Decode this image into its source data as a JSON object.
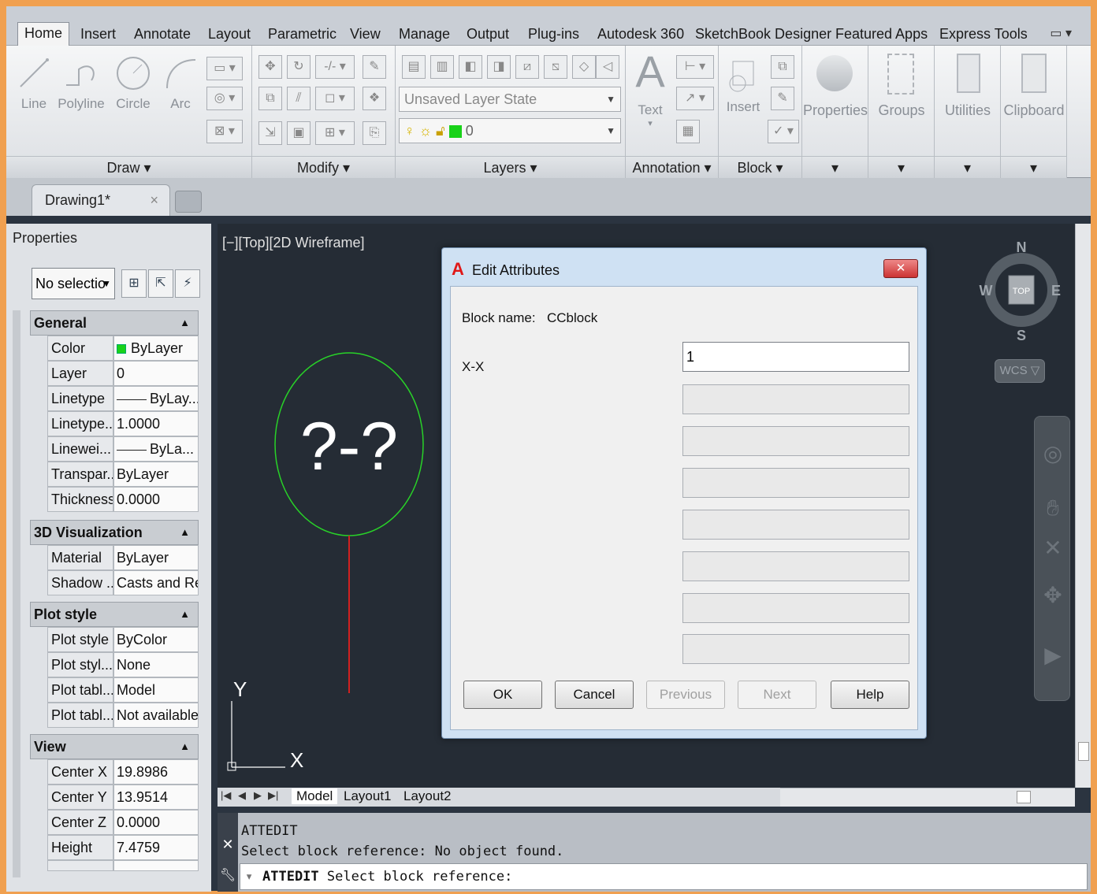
{
  "ribbon": {
    "tabs": [
      "Home",
      "Insert",
      "Annotate",
      "Layout",
      "Parametric",
      "View",
      "Manage",
      "Output",
      "Plug-ins",
      "Autodesk 360",
      "SketchBook Designer",
      "Featured Apps",
      "Express Tools"
    ],
    "active_tab": "Home",
    "extra_icon": "▭ ▾"
  },
  "draw_panel": {
    "title": "Draw ▾",
    "tools": [
      "Line",
      "Polyline",
      "Circle",
      "Arc"
    ]
  },
  "modify_panel": {
    "title": "Modify ▾"
  },
  "layers_panel": {
    "title": "Layers ▾",
    "layer_state": "Unsaved Layer State",
    "current_layer": "0"
  },
  "annotation_panel": {
    "title": "Annotation ▾",
    "text_label": "Text"
  },
  "block_panel": {
    "title": "Block ▾",
    "insert_label": "Insert"
  },
  "big_tools": [
    "Properties",
    "Groups",
    "Utilities",
    "Clipboard"
  ],
  "file_tab": {
    "name": "Drawing1*",
    "close": "×"
  },
  "properties": {
    "header": "Properties",
    "selection": "No selectio",
    "sections": {
      "general": {
        "title": "General",
        "rows": [
          {
            "k": "Color",
            "v": "ByLayer"
          },
          {
            "k": "Layer",
            "v": "0"
          },
          {
            "k": "Linetype",
            "v": "ByLay..."
          },
          {
            "k": "Linetype...",
            "v": "1.0000"
          },
          {
            "k": "Linewei...",
            "v": "ByLa..."
          },
          {
            "k": "Transpar...",
            "v": "ByLayer"
          },
          {
            "k": "Thickness",
            "v": "0.0000"
          }
        ]
      },
      "viz": {
        "title": "3D Visualization",
        "rows": [
          {
            "k": "Material",
            "v": "ByLayer"
          },
          {
            "k": "Shadow ...",
            "v": "Casts and Re..."
          }
        ]
      },
      "plot": {
        "title": "Plot style",
        "rows": [
          {
            "k": "Plot style",
            "v": "ByColor"
          },
          {
            "k": "Plot styl...",
            "v": "None"
          },
          {
            "k": "Plot tabl...",
            "v": "Model"
          },
          {
            "k": "Plot tabl...",
            "v": "Not available"
          }
        ]
      },
      "view": {
        "title": "View",
        "rows": [
          {
            "k": "Center X",
            "v": "19.8986"
          },
          {
            "k": "Center Y",
            "v": "13.9514"
          },
          {
            "k": "Center Z",
            "v": "0.0000"
          },
          {
            "k": "Height",
            "v": "7.4759"
          }
        ]
      }
    }
  },
  "viewport": {
    "label": "[−][Top][2D Wireframe]",
    "block_text": "?-?",
    "ucs_x": "X",
    "ucs_y": "Y"
  },
  "viewcube": {
    "n": "N",
    "s": "S",
    "e": "E",
    "w": "W",
    "top": "TOP",
    "wcs": "WCS ▽"
  },
  "layout_tabs": [
    "Model",
    "Layout1",
    "Layout2"
  ],
  "command": {
    "history": [
      "ATTEDIT",
      "Select block reference:  No object found."
    ],
    "prompt_cmd": "ATTEDIT",
    "prompt_text": "Select block reference:"
  },
  "dialog": {
    "title": "Edit Attributes",
    "block_name_label": "Block name:",
    "block_name": "CCblock",
    "attr_label": "X-X",
    "attr_value": "1",
    "buttons": {
      "ok": "OK",
      "cancel": "Cancel",
      "previous": "Previous",
      "next": "Next",
      "help": "Help"
    }
  },
  "colors": {
    "frame": "#f0a050",
    "canvas": "#252c35",
    "circle": "#28d228",
    "leader": "#d22020",
    "dialog": "#cfe1f3"
  }
}
